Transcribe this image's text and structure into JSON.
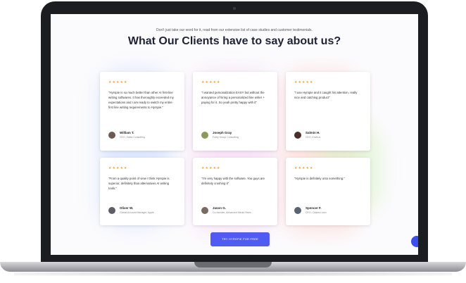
{
  "header": {
    "subtitle": "Don't just take our word for it, read from our extensive list of case studies and customer testimonials.",
    "title": "What Our Clients have to say about us?"
  },
  "stars": "★★★★★",
  "testimonials": [
    {
      "quote": "\"Hyrspie is so much better than other AI first-line writing softwares. It has thoroughly exceeded my expectations and I am ready to switch my entire first line writing requirements to Hyrspie.\"",
      "name": "William T.",
      "role": "CEO, Sales Consulting"
    },
    {
      "quote": "\"I wanted personalization EASY but without the annoyance of hiring a personalized line writer + paying for it. So yeah pretty happy with it\"",
      "name": "Joseph Gray",
      "role": "Foley Group Consulting"
    },
    {
      "quote": "\"I use Hyrspie and it caught his attention, really nice and catching product\"",
      "name": "Salmin H.",
      "role": "CEO, Envirus"
    },
    {
      "quote": "\"From a quality point of view I think Hyrspie is superior, definitely than alternatives AI writing tools.\"",
      "name": "Oliver W.",
      "role": "Global Account Manager, Apple"
    },
    {
      "quote": "\"I'm very happy with the software. You guys are definitely crushing it\"",
      "name": "Jason G.",
      "role": "Co-founder, Advanced Media Hives"
    },
    {
      "quote": "\"Hyrspie is definitely onto something.\"",
      "name": "Spencer F.",
      "role": "CEO, Clickmo.com"
    }
  ],
  "cta_label": "TRY HYRSPIE FOR FREE"
}
